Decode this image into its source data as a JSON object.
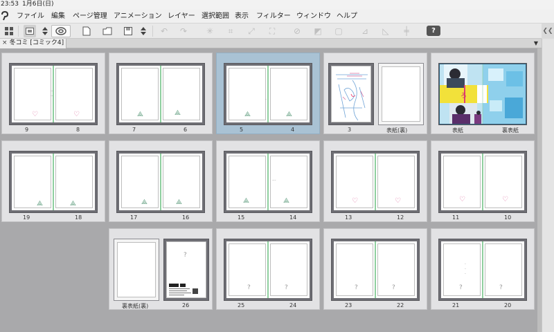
{
  "clock": {
    "time": "23:53",
    "date": "1月6日(日)"
  },
  "menu": [
    "ファイル",
    "編集",
    "ページ管理",
    "アニメーション",
    "レイヤー",
    "選択範囲",
    "表示",
    "フィルター",
    "ウィンドウ",
    "ヘルプ"
  ],
  "toolbar": {
    "help_label": "?"
  },
  "document_tab": {
    "title": "冬コミ [コミック4]",
    "close": "×"
  },
  "spreads": [
    {
      "left_label": "9",
      "right_label": "8",
      "mark": "heart"
    },
    {
      "left_label": "7",
      "right_label": "6",
      "mark": "cat"
    },
    {
      "left_label": "5",
      "right_label": "4",
      "mark": "cat"
    },
    {
      "left_label": "3",
      "right_label": "表紙(裏)",
      "mark": "sketch"
    },
    {
      "left_label": "表紙",
      "right_label": "裏表紙",
      "mark": "cover"
    },
    {
      "left_label": "19",
      "right_label": "18",
      "mark": "cat"
    },
    {
      "left_label": "17",
      "right_label": "16",
      "mark": "cat"
    },
    {
      "left_label": "15",
      "right_label": "14",
      "mark": "cat"
    },
    {
      "left_label": "13",
      "right_label": "12",
      "mark": "heart"
    },
    {
      "left_label": "11",
      "right_label": "10",
      "mark": "heart"
    },
    {
      "left_label": "裏表紙(裏)",
      "right_label": "26",
      "mark": "colophon"
    },
    {
      "left_label": "25",
      "right_label": "24",
      "mark": "q"
    },
    {
      "left_label": "23",
      "right_label": "22",
      "mark": "q"
    },
    {
      "left_label": "21",
      "right_label": "20",
      "mark": "q"
    }
  ],
  "marks": {
    "heart": "♡",
    "cat": "⟁",
    "q": "?"
  },
  "colors": {
    "selected_spread": "#a9c2d4",
    "cover_blue": "#4aa8d8",
    "cover_yellow": "#f2e13a"
  }
}
